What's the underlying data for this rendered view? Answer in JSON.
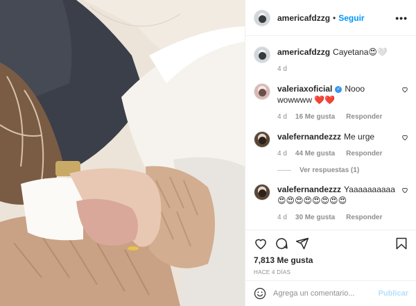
{
  "post": {
    "username": "americafdzzg",
    "separator": "•",
    "follow_label": "Seguir",
    "more_label": "•••",
    "likes": "7,813 Me gusta",
    "posted": "HACE 4 DÍAS"
  },
  "caption": {
    "username": "americafdzzg",
    "text": "Cayetana😍🤍",
    "age": "4 d"
  },
  "comments": [
    {
      "username": "valeriaxoficial",
      "verified": true,
      "text": "Nooo wowwww ❤️❤️",
      "age": "4 d",
      "likes": "16 Me gusta",
      "reply_label": "Responder"
    },
    {
      "username": "valefernandezzz",
      "text": "Me urge",
      "age": "4 d",
      "likes": "44 Me gusta",
      "reply_label": "Responder"
    },
    {
      "username": "valefernandezzz",
      "text": "Yaaaaaaaaaa😍😍😍😍😍😍😍😍",
      "age": "4 d",
      "likes": "30 Me gusta",
      "reply_label": "Responder"
    }
  ],
  "view_replies": "Ver respuestas (1)",
  "add_comment": {
    "placeholder": "Agrega un comentario...",
    "post_label": "Publicar"
  },
  "colors": {
    "link_blue": "#0095f6",
    "publish_disabled": "#b2dffc",
    "muted": "#8e8e8e"
  },
  "icons": [
    "heart-icon",
    "comment-icon",
    "share-icon",
    "bookmark-icon",
    "emoji-icon",
    "verified-badge-icon"
  ]
}
